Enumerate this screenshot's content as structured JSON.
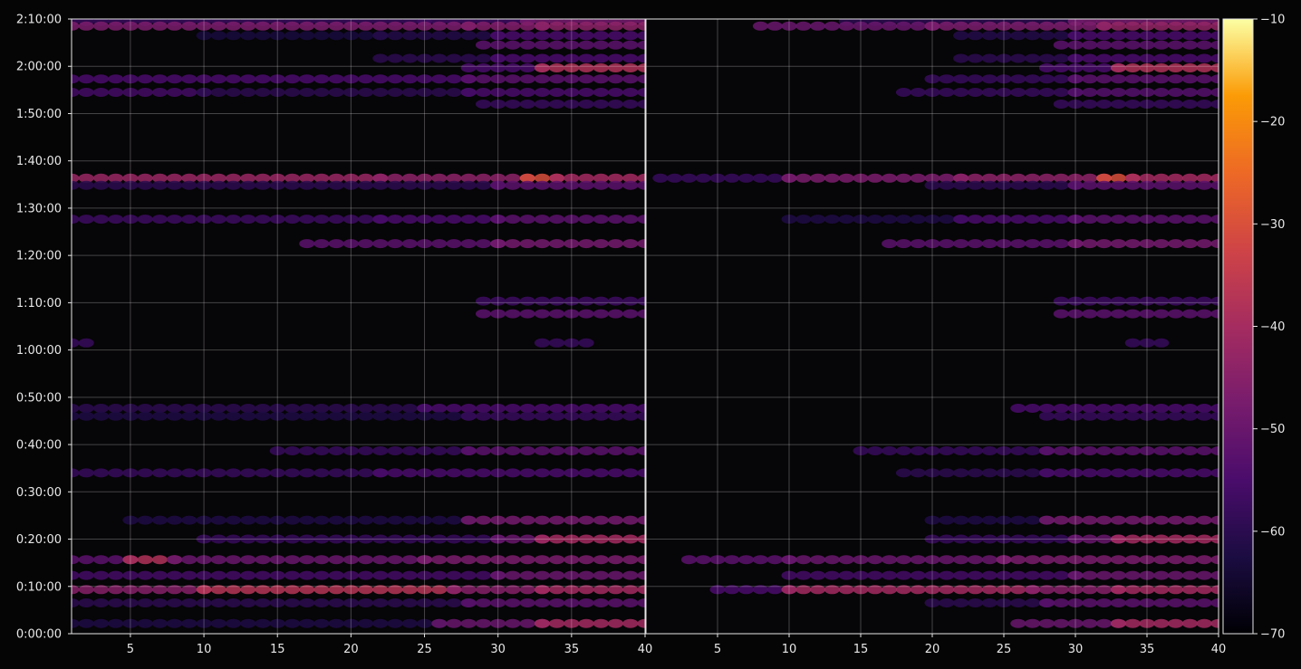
{
  "chart_data": {
    "type": "heatmap",
    "title": "",
    "xlabel": "",
    "ylabel": "",
    "panels": [
      {
        "name": "",
        "x_range": [
          1,
          40
        ],
        "x_ticks": [
          5,
          10,
          15,
          20,
          25,
          30,
          35,
          40
        ],
        "x_tick_labels": [
          "5",
          "10",
          "15",
          "20",
          "25",
          "30",
          "35",
          "40"
        ]
      },
      {
        "name": "",
        "x_range": [
          0,
          40
        ],
        "x_ticks": [
          5,
          10,
          15,
          20,
          25,
          30,
          35,
          40
        ],
        "x_tick_labels": [
          "5",
          "10",
          "15",
          "20",
          "25",
          "30",
          "35",
          "40"
        ]
      }
    ],
    "y_range_seconds": [
      0,
      7800
    ],
    "y_ticks_seconds": [
      0,
      600,
      1200,
      1800,
      2400,
      3000,
      3600,
      4200,
      4800,
      5400,
      6000,
      6600,
      7200,
      7800
    ],
    "y_tick_labels": [
      "0:00:00",
      "0:10:00",
      "0:20:00",
      "0:30:00",
      "0:40:00",
      "0:50:00",
      "1:00:00",
      "1:10:00",
      "1:20:00",
      "1:30:00",
      "1:40:00",
      "1:50:00",
      "2:00:00",
      "2:10:00"
    ],
    "colorbar": {
      "colormap": "inferno",
      "range": [
        -70,
        -10
      ],
      "ticks": [
        -10,
        -20,
        -30,
        -40,
        -50,
        -60,
        -70
      ],
      "tick_labels": [
        "−10",
        "−20",
        "−30",
        "−40",
        "−50",
        "−60",
        "−70"
      ]
    },
    "grid": true,
    "bands": [
      {
        "y": 7770,
        "left": [
          [
            1,
            25,
            -58
          ],
          [
            25,
            32,
            -57
          ],
          [
            32,
            40,
            -48
          ]
        ],
        "right": [
          [
            14,
            30,
            -60
          ],
          [
            30,
            40,
            -48
          ]
        ]
      },
      {
        "y": 7710,
        "left": [
          [
            1,
            28,
            -47
          ],
          [
            28,
            33,
            -46
          ],
          [
            33,
            40,
            -44
          ]
        ],
        "right": [
          [
            8,
            20,
            -50
          ],
          [
            20,
            32,
            -47
          ],
          [
            32,
            40,
            -43
          ]
        ]
      },
      {
        "y": 7590,
        "left": [
          [
            10,
            22,
            -63
          ],
          [
            22,
            30,
            -61
          ],
          [
            30,
            40,
            -55
          ]
        ],
        "right": [
          [
            22,
            30,
            -61
          ],
          [
            30,
            40,
            -55
          ]
        ]
      },
      {
        "y": 7470,
        "left": [
          [
            29,
            40,
            -52
          ]
        ],
        "right": [
          [
            29,
            40,
            -52
          ]
        ]
      },
      {
        "y": 7300,
        "left": [
          [
            22,
            30,
            -60
          ],
          [
            30,
            40,
            -55
          ]
        ],
        "right": [
          [
            22,
            30,
            -60
          ],
          [
            30,
            40,
            -55
          ]
        ]
      },
      {
        "y": 7180,
        "left": [
          [
            28,
            33,
            -55
          ],
          [
            33,
            40,
            -38
          ]
        ],
        "right": [
          [
            28,
            33,
            -55
          ],
          [
            33,
            40,
            -38
          ]
        ]
      },
      {
        "y": 7040,
        "left": [
          [
            1,
            28,
            -55
          ],
          [
            28,
            40,
            -52
          ]
        ],
        "right": [
          [
            20,
            30,
            -58
          ],
          [
            30,
            40,
            -52
          ]
        ]
      },
      {
        "y": 6870,
        "left": [
          [
            1,
            10,
            -56
          ],
          [
            10,
            28,
            -60
          ],
          [
            28,
            40,
            -55
          ]
        ],
        "right": [
          [
            18,
            30,
            -58
          ],
          [
            30,
            40,
            -53
          ]
        ]
      },
      {
        "y": 6720,
        "left": [
          [
            29,
            40,
            -58
          ]
        ],
        "right": [
          [
            29,
            40,
            -58
          ]
        ]
      },
      {
        "y": 5780,
        "left": [
          [
            1,
            22,
            -42
          ],
          [
            22,
            32,
            -44
          ],
          [
            32,
            34,
            -30
          ],
          [
            34,
            40,
            -40
          ]
        ],
        "right": [
          [
            1,
            10,
            -58
          ],
          [
            10,
            22,
            -47
          ],
          [
            22,
            32,
            -44
          ],
          [
            32,
            34,
            -30
          ],
          [
            34,
            40,
            -40
          ]
        ]
      },
      {
        "y": 5690,
        "left": [
          [
            1,
            30,
            -60
          ],
          [
            30,
            40,
            -52
          ]
        ],
        "right": [
          [
            20,
            30,
            -60
          ],
          [
            30,
            40,
            -52
          ]
        ]
      },
      {
        "y": 5260,
        "left": [
          [
            1,
            22,
            -57
          ],
          [
            22,
            30,
            -55
          ],
          [
            30,
            40,
            -52
          ]
        ],
        "right": [
          [
            10,
            22,
            -62
          ],
          [
            22,
            30,
            -55
          ],
          [
            30,
            40,
            -52
          ]
        ]
      },
      {
        "y": 4950,
        "left": [
          [
            17,
            30,
            -52
          ],
          [
            30,
            40,
            -48
          ]
        ],
        "right": [
          [
            17,
            30,
            -52
          ],
          [
            30,
            40,
            -48
          ]
        ]
      },
      {
        "y": 4220,
        "left": [
          [
            29,
            40,
            -57
          ]
        ],
        "right": [
          [
            29,
            40,
            -57
          ]
        ]
      },
      {
        "y": 4060,
        "left": [
          [
            29,
            40,
            -52
          ]
        ],
        "right": [
          [
            29,
            40,
            -52
          ]
        ]
      },
      {
        "y": 3690,
        "left": [
          [
            1,
            2,
            -58
          ],
          [
            33,
            36,
            -58
          ]
        ],
        "right": [
          [
            34,
            36,
            -58
          ]
        ]
      },
      {
        "y": 2860,
        "left": [
          [
            1,
            25,
            -60
          ],
          [
            25,
            40,
            -55
          ]
        ],
        "right": [
          [
            26,
            40,
            -55
          ]
        ]
      },
      {
        "y": 2760,
        "left": [
          [
            1,
            28,
            -62
          ],
          [
            28,
            40,
            -58
          ]
        ],
        "right": [
          [
            28,
            40,
            -58
          ]
        ]
      },
      {
        "y": 2320,
        "left": [
          [
            15,
            28,
            -58
          ],
          [
            28,
            40,
            -52
          ]
        ],
        "right": [
          [
            15,
            28,
            -58
          ],
          [
            28,
            40,
            -52
          ]
        ]
      },
      {
        "y": 2040,
        "left": [
          [
            1,
            22,
            -58
          ],
          [
            22,
            40,
            -55
          ]
        ],
        "right": [
          [
            18,
            28,
            -60
          ],
          [
            28,
            40,
            -55
          ]
        ]
      },
      {
        "y": 1440,
        "left": [
          [
            5,
            28,
            -62
          ],
          [
            28,
            40,
            -48
          ]
        ],
        "right": [
          [
            20,
            28,
            -62
          ],
          [
            28,
            40,
            -48
          ]
        ]
      },
      {
        "y": 1200,
        "left": [
          [
            10,
            30,
            -58
          ],
          [
            30,
            33,
            -50
          ],
          [
            33,
            40,
            -40
          ]
        ],
        "right": [
          [
            20,
            30,
            -58
          ],
          [
            30,
            33,
            -50
          ],
          [
            33,
            40,
            -40
          ]
        ]
      },
      {
        "y": 940,
        "left": [
          [
            1,
            5,
            -52
          ],
          [
            5,
            8,
            -38
          ],
          [
            8,
            25,
            -50
          ],
          [
            25,
            40,
            -47
          ]
        ],
        "right": [
          [
            3,
            10,
            -52
          ],
          [
            10,
            25,
            -50
          ],
          [
            25,
            40,
            -47
          ]
        ]
      },
      {
        "y": 740,
        "left": [
          [
            1,
            30,
            -56
          ],
          [
            30,
            40,
            -50
          ]
        ],
        "right": [
          [
            10,
            30,
            -56
          ],
          [
            30,
            40,
            -50
          ]
        ]
      },
      {
        "y": 560,
        "left": [
          [
            1,
            10,
            -45
          ],
          [
            10,
            27,
            -37
          ],
          [
            27,
            33,
            -45
          ],
          [
            33,
            40,
            -40
          ]
        ],
        "right": [
          [
            5,
            10,
            -55
          ],
          [
            10,
            27,
            -40
          ],
          [
            27,
            33,
            -45
          ],
          [
            33,
            40,
            -40
          ]
        ]
      },
      {
        "y": 390,
        "left": [
          [
            1,
            28,
            -60
          ],
          [
            28,
            40,
            -52
          ]
        ],
        "right": [
          [
            20,
            28,
            -60
          ],
          [
            28,
            40,
            -52
          ]
        ]
      },
      {
        "y": 130,
        "left": [
          [
            1,
            26,
            -62
          ],
          [
            26,
            33,
            -50
          ],
          [
            33,
            40,
            -40
          ]
        ],
        "right": [
          [
            26,
            33,
            -50
          ],
          [
            33,
            40,
            -40
          ]
        ]
      }
    ]
  }
}
